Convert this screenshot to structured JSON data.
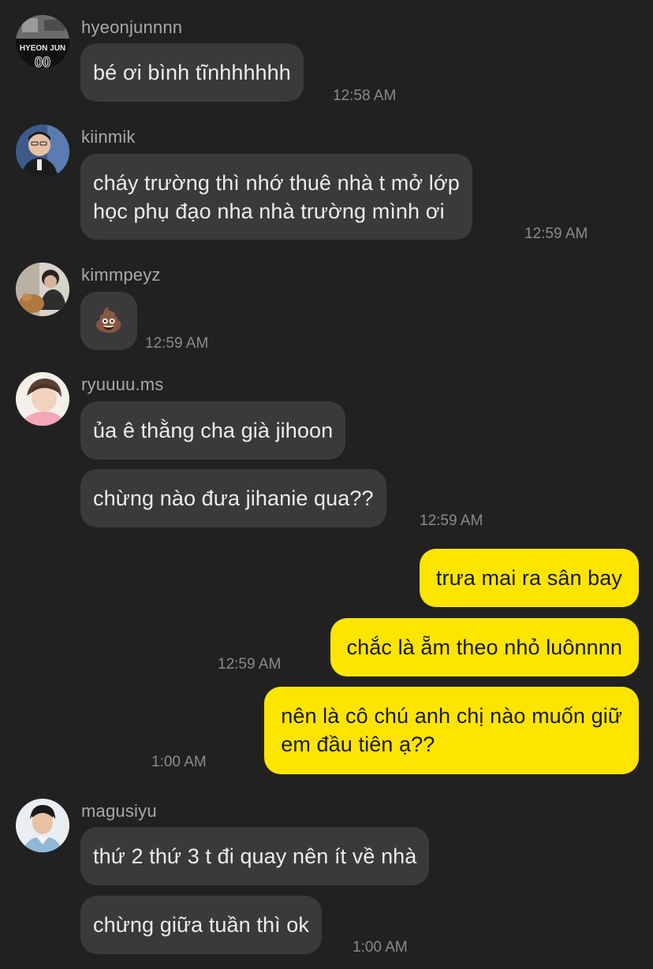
{
  "messages": [
    {
      "user": "hyeonjunnnn",
      "text": "bé ơi bình tĩnhhhhhh",
      "time": "12:58 AM"
    },
    {
      "user": "kiinmik",
      "line1": "cháy trường thì nhớ thuê nhà t mở lớp",
      "line2": "học phụ đạo nha nhà trường mình ơi",
      "time": "12:59 AM"
    },
    {
      "user": "kimmpeyz",
      "emoji": "💩",
      "time": "12:59 AM"
    },
    {
      "user": "ryuuuu.ms",
      "text1": "ủa ê thằng cha già jihoon",
      "text2": "chừng nào đưa jihanie qua??",
      "time": "12:59 AM"
    },
    {
      "outgoing": true,
      "text1": "trưa mai ra sân bay",
      "text2": "chắc là ẵm theo nhỏ luônnnn",
      "time1": "12:59 AM",
      "line1": "nên là cô chú anh chị nào muốn giữ",
      "line2": "em đầu tiên ạ??",
      "time2": "1:00 AM"
    },
    {
      "user": "magusiyu",
      "text1": "thứ 2 thứ 3 t đi quay nên ít về nhà",
      "text2": "chừng giữa tuần thì ok",
      "time": "1:00 AM"
    }
  ],
  "avatar_labels": {
    "hyeonjun": "HYEON JUN"
  },
  "colors": {
    "background": "#212121",
    "incoming_bubble": "#3a3a3c",
    "outgoing_bubble": "#fee500",
    "username": "#a9a9a9",
    "timestamp": "#8a8a8a"
  }
}
